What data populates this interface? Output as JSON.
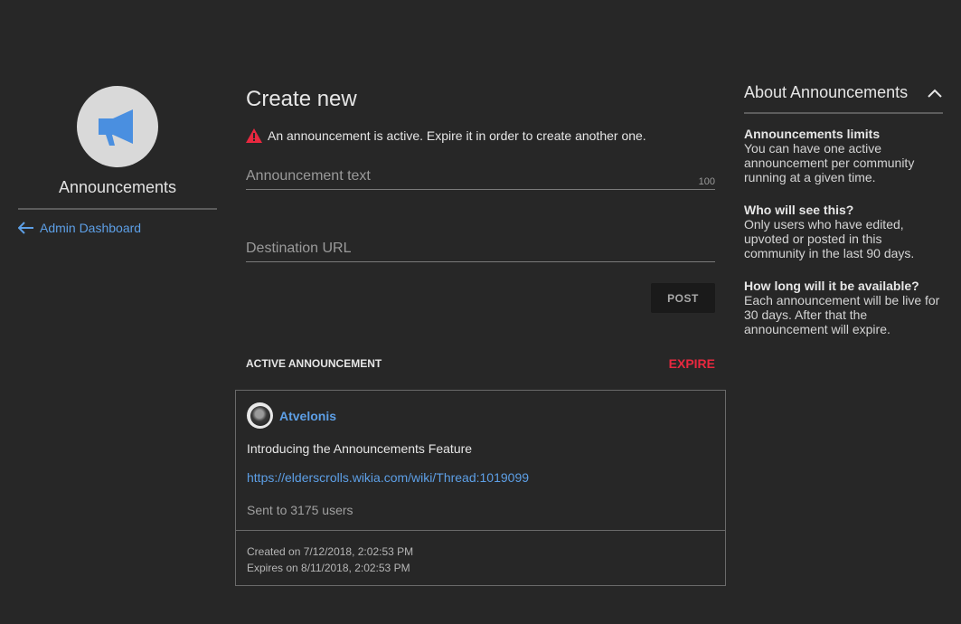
{
  "sidebar": {
    "title": "Announcements",
    "icon": "megaphone-icon",
    "back_link": "Admin Dashboard"
  },
  "main": {
    "title": "Create new",
    "warning": "An announcement is active. Expire it in order to create another one.",
    "text_placeholder": "Announcement text",
    "char_limit": "100",
    "url_placeholder": "Destination URL",
    "post_label": "POST",
    "active_label": "ACTIVE ANNOUNCEMENT",
    "expire_label": "EXPIRE"
  },
  "announcement": {
    "username": "Atvelonis",
    "text": "Introducing the Announcements Feature",
    "link": "https://elderscrolls.wikia.com/wiki/Thread:1019099",
    "sent": "Sent to 3175 users",
    "created": "Created on 7/12/2018, 2:02:53 PM",
    "expires": "Expires on 8/11/2018, 2:02:53 PM"
  },
  "about": {
    "title": "About Announcements",
    "sections": [
      {
        "title": "Announcements limits",
        "body": "You can have one active announcement per community running at a given time."
      },
      {
        "title": "Who will see this?",
        "body": "Only users who have edited, upvoted or posted in this community in the last 90 days."
      },
      {
        "title": "How long will it be available?",
        "body": "Each announcement will be live for 30 days. After that the announcement will expire."
      }
    ]
  },
  "colors": {
    "background": "#272727",
    "link": "#5d9fe6",
    "danger": "#e8283f",
    "icon_blue": "#4a8fe0"
  }
}
